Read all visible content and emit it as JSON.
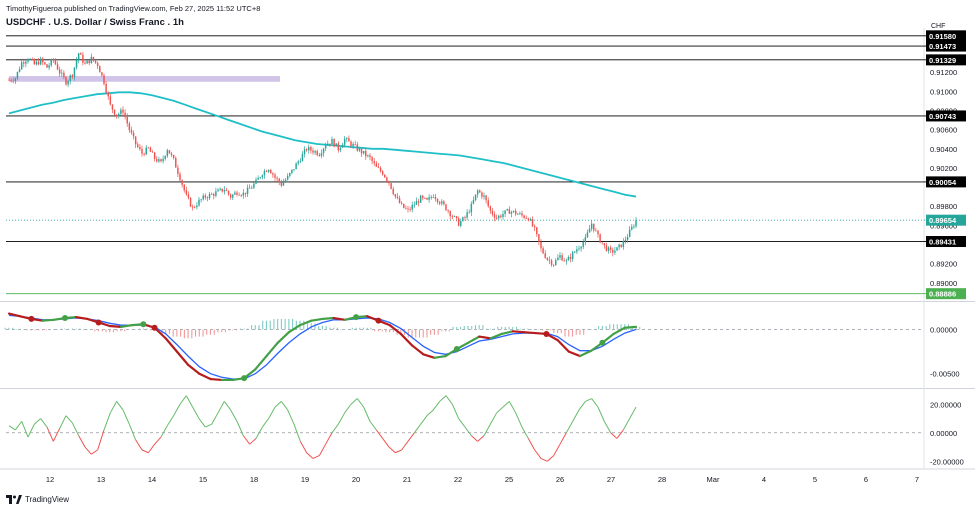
{
  "header": {
    "published": "TimothyFigueroa published on TradingView.com, Feb 27, 2025 11:52 UTC+8",
    "title": "USDCHF . U.S. Dollar / Swiss Franc . 1h",
    "currency": "CHF"
  },
  "footer": {
    "brand": "TradingView"
  },
  "colors": {
    "up": "#26a69a",
    "down": "#ef5350",
    "ma": "#1fbfc7",
    "zone": "#b39ddb",
    "macd_fast_up": "#43a047",
    "macd_fast_down": "#b71c1c",
    "macd_slow": "#2962ff",
    "osc_up": "#66bb6a",
    "osc_down": "#ef5350",
    "last_tag": "#26a69a",
    "green_line": "#4caf50"
  },
  "chart_data": [
    {
      "type": "candlestick",
      "title": "USDCHF . U.S. Dollar / Swiss Franc . 1h",
      "x_ticks": [
        "12",
        "13",
        "14",
        "15",
        "18",
        "19",
        "20",
        "21",
        "22",
        "25",
        "26",
        "27",
        "28",
        "Mar",
        "4",
        "5",
        "6",
        "7"
      ],
      "y_ticks": [
        "0.91200",
        "0.91000",
        "0.90800",
        "0.90600",
        "0.90400",
        "0.90200",
        "0.89800",
        "0.89600",
        "0.89200",
        "0.89000"
      ],
      "ylim": [
        0.8882,
        0.9162
      ],
      "close_path": [
        0.9112,
        0.9114,
        0.913,
        0.9135,
        0.9128,
        0.9132,
        0.9125,
        0.9133,
        0.912,
        0.911,
        0.9118,
        0.914,
        0.9128,
        0.9134,
        0.9128,
        0.911,
        0.9085,
        0.9075,
        0.908,
        0.906,
        0.9045,
        0.9035,
        0.904,
        0.903,
        0.9025,
        0.904,
        0.9028,
        0.901,
        0.899,
        0.8978,
        0.8985,
        0.899,
        0.8992,
        0.8995,
        0.8998,
        0.899,
        0.8995,
        0.8993,
        0.8998,
        0.9005,
        0.9015,
        0.902,
        0.901,
        0.9003,
        0.901,
        0.902,
        0.903,
        0.904,
        0.9038,
        0.9035,
        0.9045,
        0.9048,
        0.904,
        0.905,
        0.9045,
        0.904,
        0.9035,
        0.903,
        0.902,
        0.9015,
        0.9005,
        0.899,
        0.898,
        0.8975,
        0.8982,
        0.8988,
        0.8985,
        0.8992,
        0.8985,
        0.8978,
        0.897,
        0.8962,
        0.8968,
        0.898,
        0.8996,
        0.899,
        0.8975,
        0.8968,
        0.8972,
        0.8975,
        0.8973,
        0.897,
        0.8968,
        0.8955,
        0.8935,
        0.8925,
        0.892,
        0.8928,
        0.8922,
        0.893,
        0.8938,
        0.8945,
        0.8962,
        0.8948,
        0.8938,
        0.8932,
        0.8935,
        0.8942,
        0.8953,
        0.8965
      ],
      "ma_path": [
        0.9077,
        0.908,
        0.9083,
        0.9086,
        0.9088,
        0.9091,
        0.9093,
        0.9095,
        0.9097,
        0.9098,
        0.9099,
        0.9099,
        0.9098,
        0.9096,
        0.9093,
        0.909,
        0.9086,
        0.9082,
        0.9078,
        0.9074,
        0.907,
        0.9066,
        0.9062,
        0.9058,
        0.9055,
        0.9052,
        0.9049,
        0.9047,
        0.9045,
        0.9044,
        0.9043,
        0.9042,
        0.9041,
        0.904,
        0.904,
        0.9039,
        0.9038,
        0.9037,
        0.9036,
        0.9035,
        0.9034,
        0.9033,
        0.9031,
        0.9029,
        0.9027,
        0.9025,
        0.9022,
        0.9019,
        0.9016,
        0.9013,
        0.901,
        0.9007,
        0.9004,
        0.9001,
        0.8998,
        0.8995,
        0.8992,
        0.899
      ],
      "zone": {
        "x_start_index": 0,
        "x_end_index": 42,
        "low": 0.911,
        "high": 0.9116
      },
      "levels": [
        {
          "value": 0.9158,
          "label": "0.91580",
          "color": "#000000"
        },
        {
          "value": 0.91473,
          "label": "0.91473",
          "color": "#000000"
        },
        {
          "value": 0.91329,
          "label": "0.91329",
          "color": "#000000"
        },
        {
          "value": 0.90743,
          "label": "0.90743",
          "color": "#000000"
        },
        {
          "value": 0.90054,
          "label": "0.90054",
          "color": "#000000"
        },
        {
          "value": 0.89431,
          "label": "0.89431",
          "color": "#000000"
        },
        {
          "value": 0.88886,
          "label": "0.88886",
          "color": "#4caf50"
        }
      ],
      "last_price": {
        "value": 0.89654,
        "label": "0.89654"
      }
    },
    {
      "type": "line",
      "name": "macd",
      "y_ticks": [
        "0.00000",
        "-0.00500"
      ],
      "ylim": [
        -0.0065,
        0.003
      ],
      "fast": [
        0.0018,
        0.0015,
        0.0012,
        0.001,
        0.0011,
        0.0013,
        0.0014,
        0.0012,
        0.0008,
        0.0004,
        0.0003,
        0.0005,
        0.0006,
        0.0002,
        -0.001,
        -0.0025,
        -0.004,
        -0.005,
        -0.0056,
        -0.0057,
        -0.0057,
        -0.0055,
        -0.0045,
        -0.003,
        -0.0015,
        -0.0003,
        0.0005,
        0.001,
        0.0012,
        0.0013,
        0.0011,
        0.0014,
        0.0015,
        0.001,
        0.0005,
        -0.0005,
        -0.0018,
        -0.0028,
        -0.0032,
        -0.003,
        -0.0022,
        -0.0015,
        -0.0008,
        -0.001,
        -0.0005,
        -0.0002,
        -0.0003,
        -0.0004,
        -0.0005,
        -0.0012,
        -0.0025,
        -0.003,
        -0.0024,
        -0.0015,
        -0.0005,
        0.0002,
        0.0003
      ],
      "slow": [
        0.0016,
        0.0015,
        0.0013,
        0.0011,
        0.0011,
        0.0012,
        0.0013,
        0.0012,
        0.001,
        0.0007,
        0.0005,
        0.0005,
        0.0005,
        0.0003,
        -0.0005,
        -0.0017,
        -0.003,
        -0.0042,
        -0.005,
        -0.0054,
        -0.0056,
        -0.0056,
        -0.005,
        -0.004,
        -0.0027,
        -0.0015,
        -0.0005,
        0.0003,
        0.0008,
        0.0011,
        0.0011,
        0.0012,
        0.0013,
        0.0012,
        0.0008,
        0.0001,
        -0.0009,
        -0.0019,
        -0.0026,
        -0.0028,
        -0.0025,
        -0.0019,
        -0.0013,
        -0.0011,
        -0.0008,
        -0.0005,
        -0.0004,
        -0.0004,
        -0.0004,
        -0.0008,
        -0.0017,
        -0.0024,
        -0.0024,
        -0.0019,
        -0.0011,
        -0.0004,
        0.0
      ],
      "histogram": [
        0.0002,
        0.0,
        -0.0001,
        -0.0001,
        0.0,
        0.0001,
        0.0001,
        0.0,
        -0.0002,
        -0.0003,
        -0.0002,
        0.0,
        0.0001,
        -0.0001,
        -0.0005,
        -0.0008,
        -0.001,
        -0.0008,
        -0.0006,
        -0.0003,
        -0.0001,
        0.0001,
        0.0005,
        0.001,
        0.0012,
        0.0012,
        0.001,
        0.0007,
        0.0004,
        0.0002,
        0.0,
        0.0002,
        0.0002,
        -0.0002,
        -0.0003,
        -0.0006,
        -0.0009,
        -0.0009,
        -0.0006,
        -0.0002,
        0.0003,
        0.0004,
        0.0005,
        0.0001,
        0.0003,
        0.0003,
        0.0001,
        0.0,
        -0.0001,
        -0.0004,
        -0.0008,
        -0.0006,
        0.0,
        0.0004,
        0.0006,
        0.0006,
        0.0003
      ]
    },
    {
      "type": "line",
      "name": "oscillator",
      "y_ticks": [
        "20.00000",
        "0.00000",
        "-20.00000"
      ],
      "ylim": [
        -24,
        30
      ],
      "values": [
        5,
        2,
        8,
        -3,
        6,
        10,
        4,
        -6,
        3,
        12,
        7,
        -2,
        -10,
        -15,
        -12,
        2,
        14,
        22,
        16,
        6,
        -5,
        -12,
        -14,
        -8,
        -3,
        5,
        12,
        20,
        26,
        18,
        10,
        4,
        6,
        14,
        22,
        16,
        8,
        -2,
        -8,
        -4,
        4,
        10,
        18,
        22,
        16,
        6,
        -6,
        -14,
        -18,
        -16,
        -8,
        0,
        6,
        14,
        20,
        24,
        18,
        8,
        2,
        -4,
        -10,
        -14,
        -12,
        -6,
        0,
        6,
        12,
        16,
        22,
        26,
        20,
        10,
        4,
        -2,
        -6,
        -2,
        6,
        14,
        18,
        22,
        14,
        4,
        -4,
        -12,
        -18,
        -20,
        -16,
        -8,
        0,
        8,
        16,
        22,
        24,
        18,
        8,
        0,
        -4,
        2,
        10,
        18
      ]
    }
  ]
}
